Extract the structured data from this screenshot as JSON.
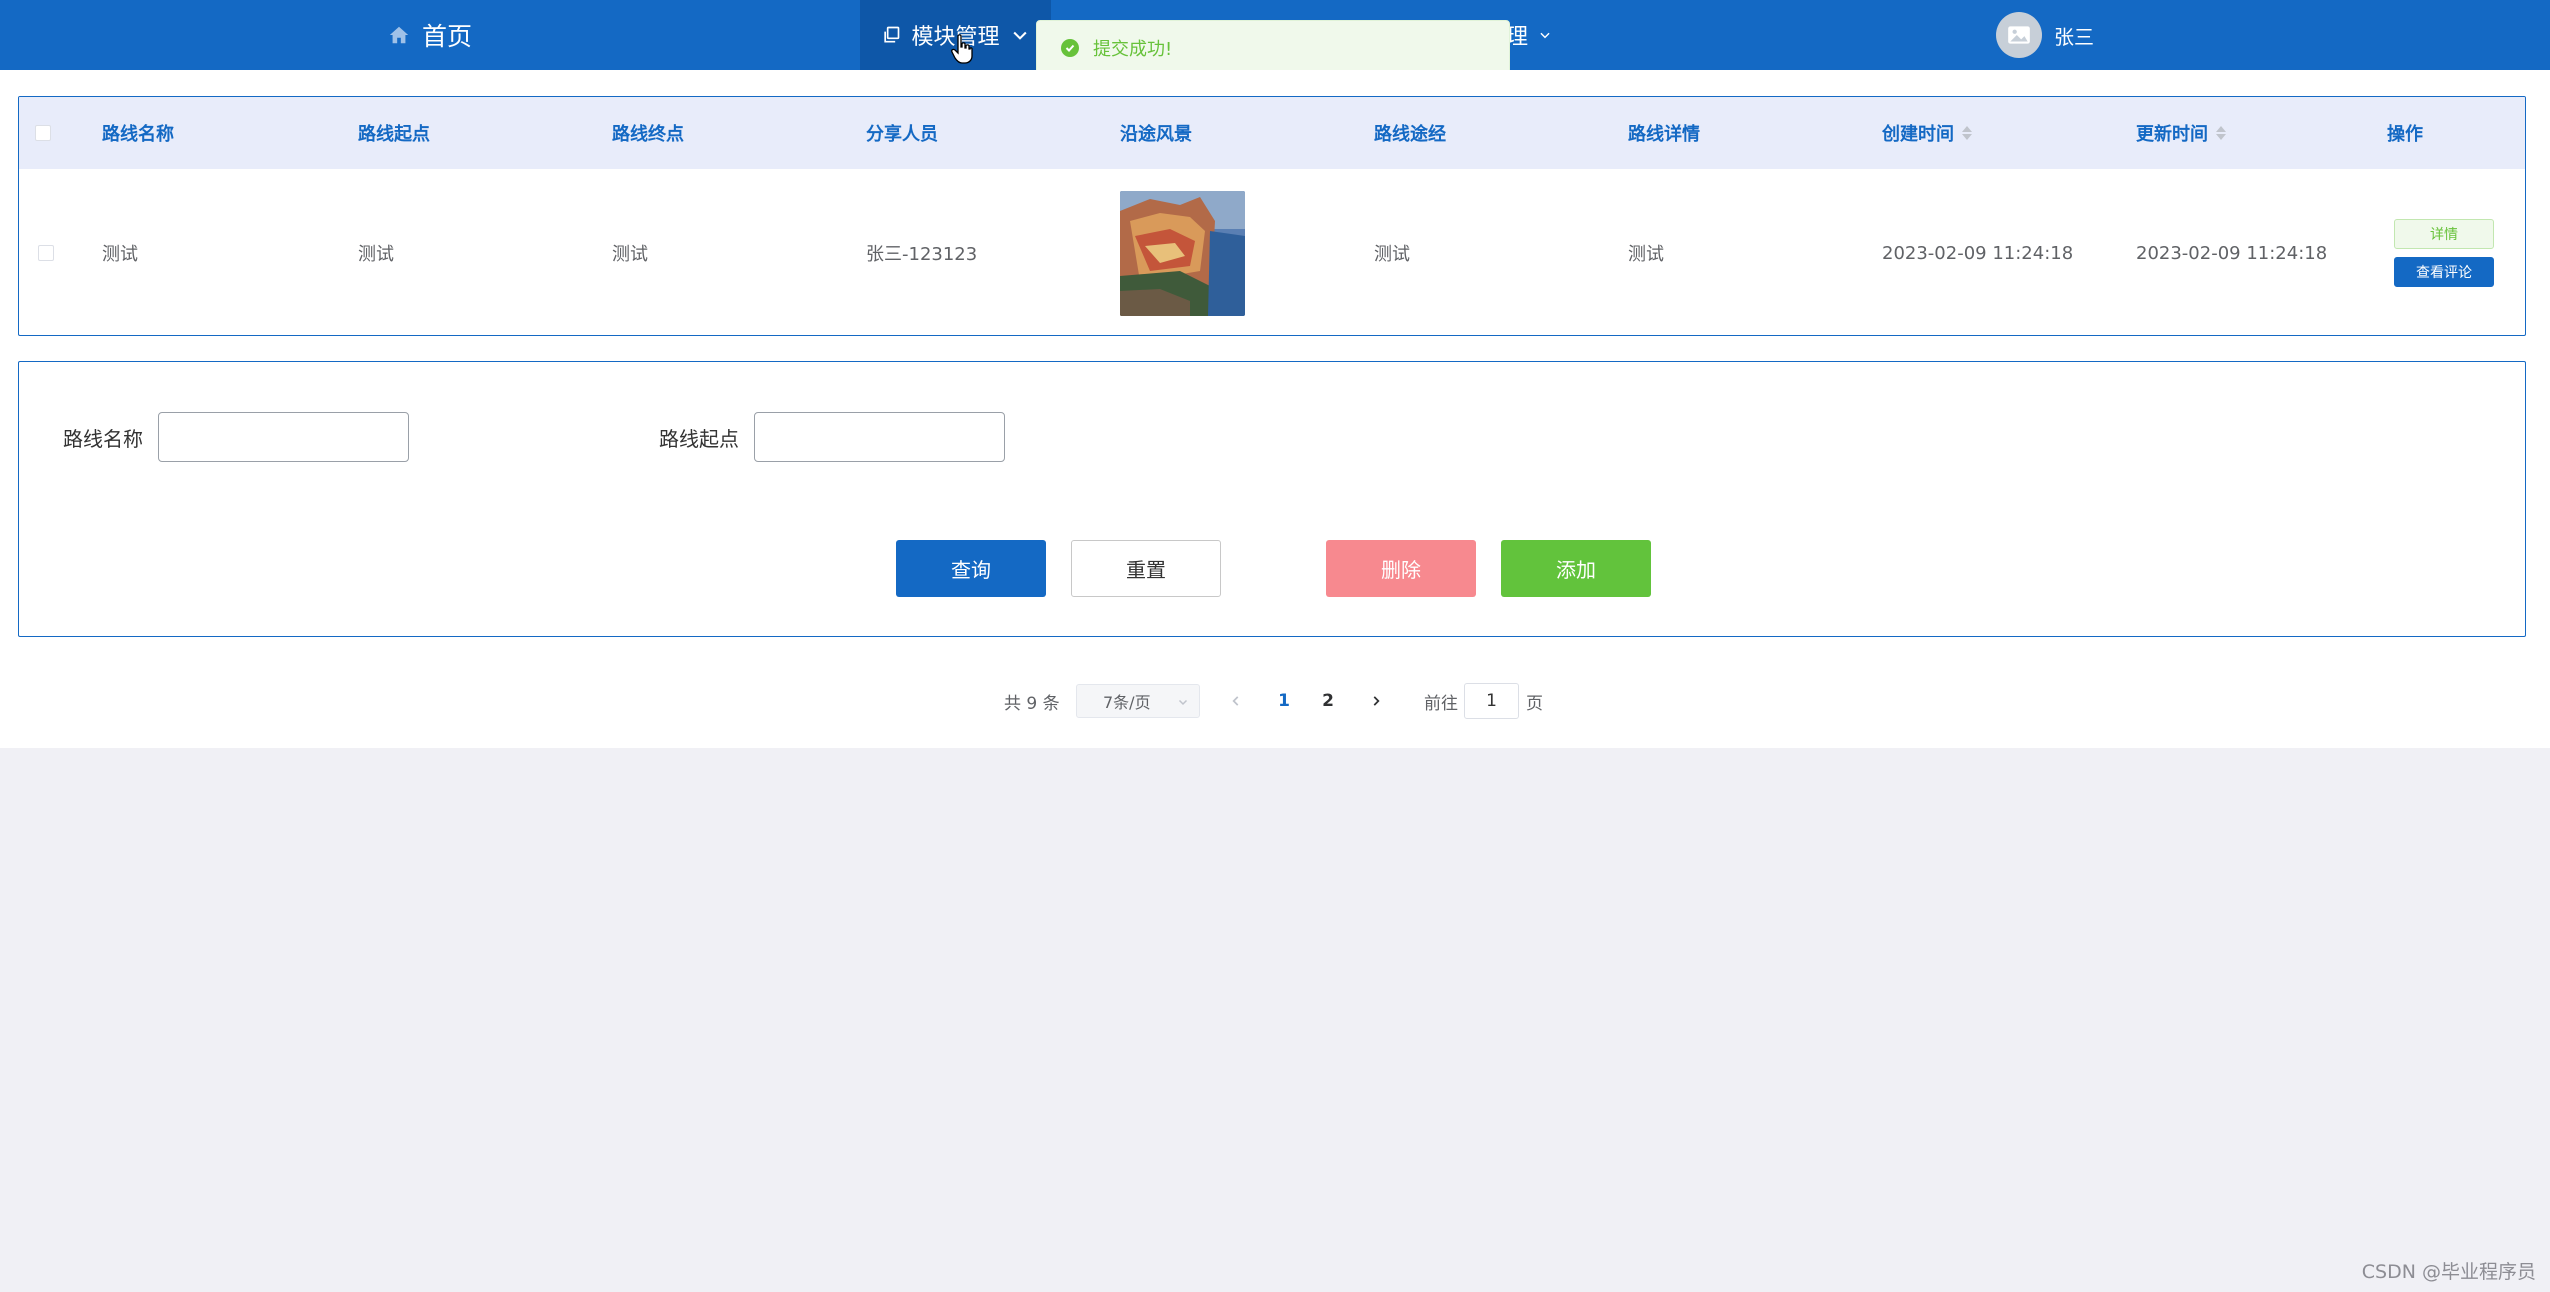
{
  "nav": {
    "home_label": "首页",
    "module_label": "模块管理",
    "hidden_suffix": "理",
    "user_name": "张三"
  },
  "toast": {
    "message": "提交成功!"
  },
  "table": {
    "headers": [
      "路线名称",
      "路线起点",
      "路线终点",
      "分享人员",
      "沿途风景",
      "路线途经",
      "路线详情",
      "创建时间",
      "更新时间",
      "操作"
    ],
    "rows": [
      {
        "name": "测试",
        "start": "测试",
        "end": "测试",
        "sharer": "张三-123123",
        "via": "测试",
        "detail": "测试",
        "created": "2023-02-09 11:24:18",
        "updated": "2023-02-09 11:24:18",
        "action_detail": "详情",
        "action_comment": "查看评论"
      }
    ]
  },
  "search": {
    "name_label": "路线名称",
    "start_label": "路线起点",
    "name_value": "",
    "start_value": "",
    "query_button": "查询",
    "reset_button": "重置",
    "delete_button": "删除",
    "add_button": "添加"
  },
  "pagination": {
    "total_text": "共 9 条",
    "page_size": "7条/页",
    "pages": [
      "1",
      "2"
    ],
    "current_page": "1",
    "goto_label": "前往",
    "goto_value": "1",
    "page_suffix": "页"
  },
  "watermark": "CSDN @毕业程序员",
  "colors": {
    "primary": "#1469c4",
    "success": "#67c23a",
    "danger": "#f7898f",
    "add": "#62c33c"
  }
}
